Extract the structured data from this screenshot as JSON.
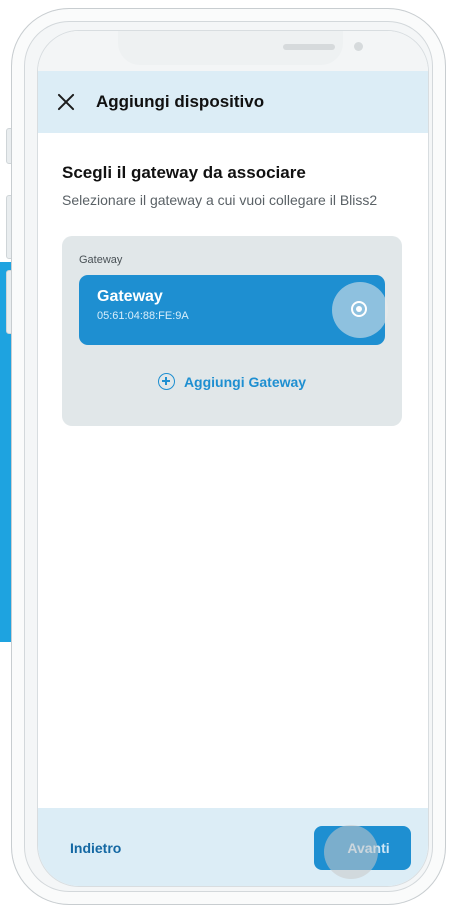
{
  "header": {
    "title": "Aggiungi dispositivo",
    "close_icon": "close-icon"
  },
  "main": {
    "section_title": "Scegli il gateway da associare",
    "section_subtitle": "Selezionare il gateway a cui vuoi collegare il Bliss2",
    "panel_label": "Gateway",
    "gateways": [
      {
        "name": "Gateway",
        "mac": "05:61:04:88:FE:9A",
        "selected": true
      }
    ],
    "add_gateway_label": "Aggiungi Gateway",
    "add_gateway_icon": "plus-circle-icon"
  },
  "footer": {
    "back_label": "Indietro",
    "next_label": "Avanti"
  },
  "colors": {
    "accent": "#1e8fd1",
    "header_bg": "#dcedf6",
    "panel_bg": "#e1e7e9"
  }
}
